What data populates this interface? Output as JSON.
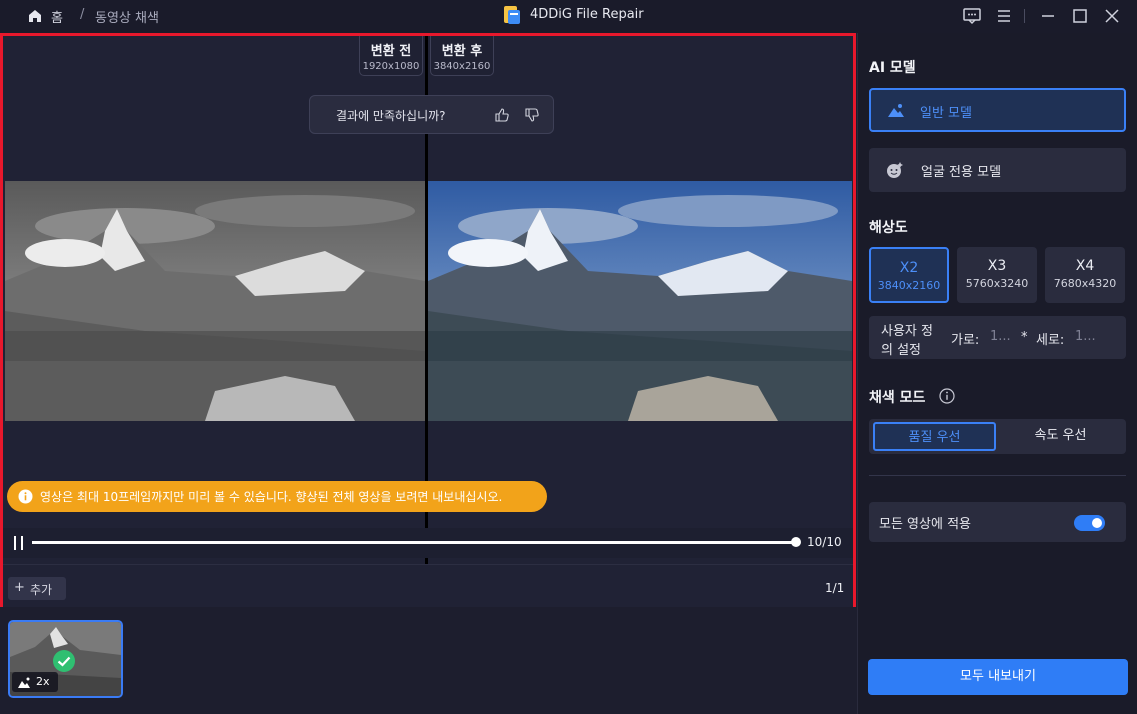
{
  "titlebar": {
    "home_label": "홈",
    "separator": "/",
    "breadcrumb_current": "동영상 채색",
    "app_title": "4DDiG File Repair"
  },
  "preview": {
    "before_label": "변환 전",
    "before_res": "1920x1080",
    "after_label": "변환 후",
    "after_res": "3840x2160",
    "feedback_question": "결과에 만족하십니까?",
    "notice_text": "영상은 최대 10프레임까지만 미리 볼 수 있습니다. 향상된 전체 영상을 보려면 내보내십시오.",
    "frame_counter": "10/10",
    "progress": 1.0,
    "add_label": "추가",
    "page_counter": "1/1"
  },
  "thumbnail": {
    "scale_label": "2x"
  },
  "panel": {
    "ai_model_title": "AI 모델",
    "model_general": "일반 모델",
    "model_face": "얼굴 전용 모델",
    "resolution_title": "해상도",
    "resolutions": [
      {
        "label": "X2",
        "size": "3840x2160"
      },
      {
        "label": "X3",
        "size": "5760x3240"
      },
      {
        "label": "X4",
        "size": "7680x4320"
      }
    ],
    "custom_label_1": "사용자 정",
    "custom_label_2": "의 설정",
    "width_label": "가로:",
    "width_placeholder": "1...",
    "times": "*",
    "height_label": "세로:",
    "height_placeholder": "1...",
    "color_mode_title": "채색 모드",
    "mode_quality": "품질 우선",
    "mode_speed": "속도 우선",
    "apply_all_label": "모든 영상에 적용",
    "export_all": "모두 내보내기"
  },
  "colors": {
    "accent": "#2f7df6",
    "highlight_border": "#e8182c",
    "notice": "#f2a31a",
    "success": "#2fbf71"
  }
}
